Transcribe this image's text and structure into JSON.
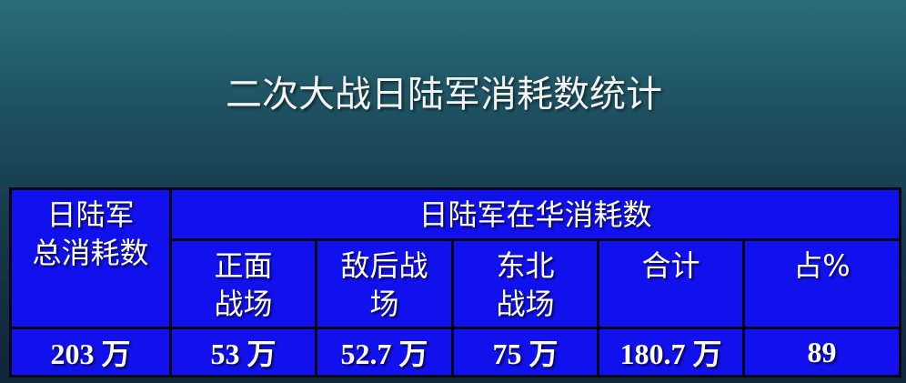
{
  "title": "二次大战日陆军消耗数统计",
  "table": {
    "total_header": "日陆军\n总消耗数",
    "china_header": "日陆军在华消耗数",
    "columns": [
      {
        "label": "正面\n战场"
      },
      {
        "label": "敌后战\n场"
      },
      {
        "label": "东北\n战场"
      },
      {
        "label": "合计"
      },
      {
        "label": "占%"
      }
    ],
    "values": {
      "total": "203 万",
      "front": "53 万",
      "behind": "52.7 万",
      "northeast": "75 万",
      "sum": "180.7 万",
      "percent": "89"
    }
  }
}
